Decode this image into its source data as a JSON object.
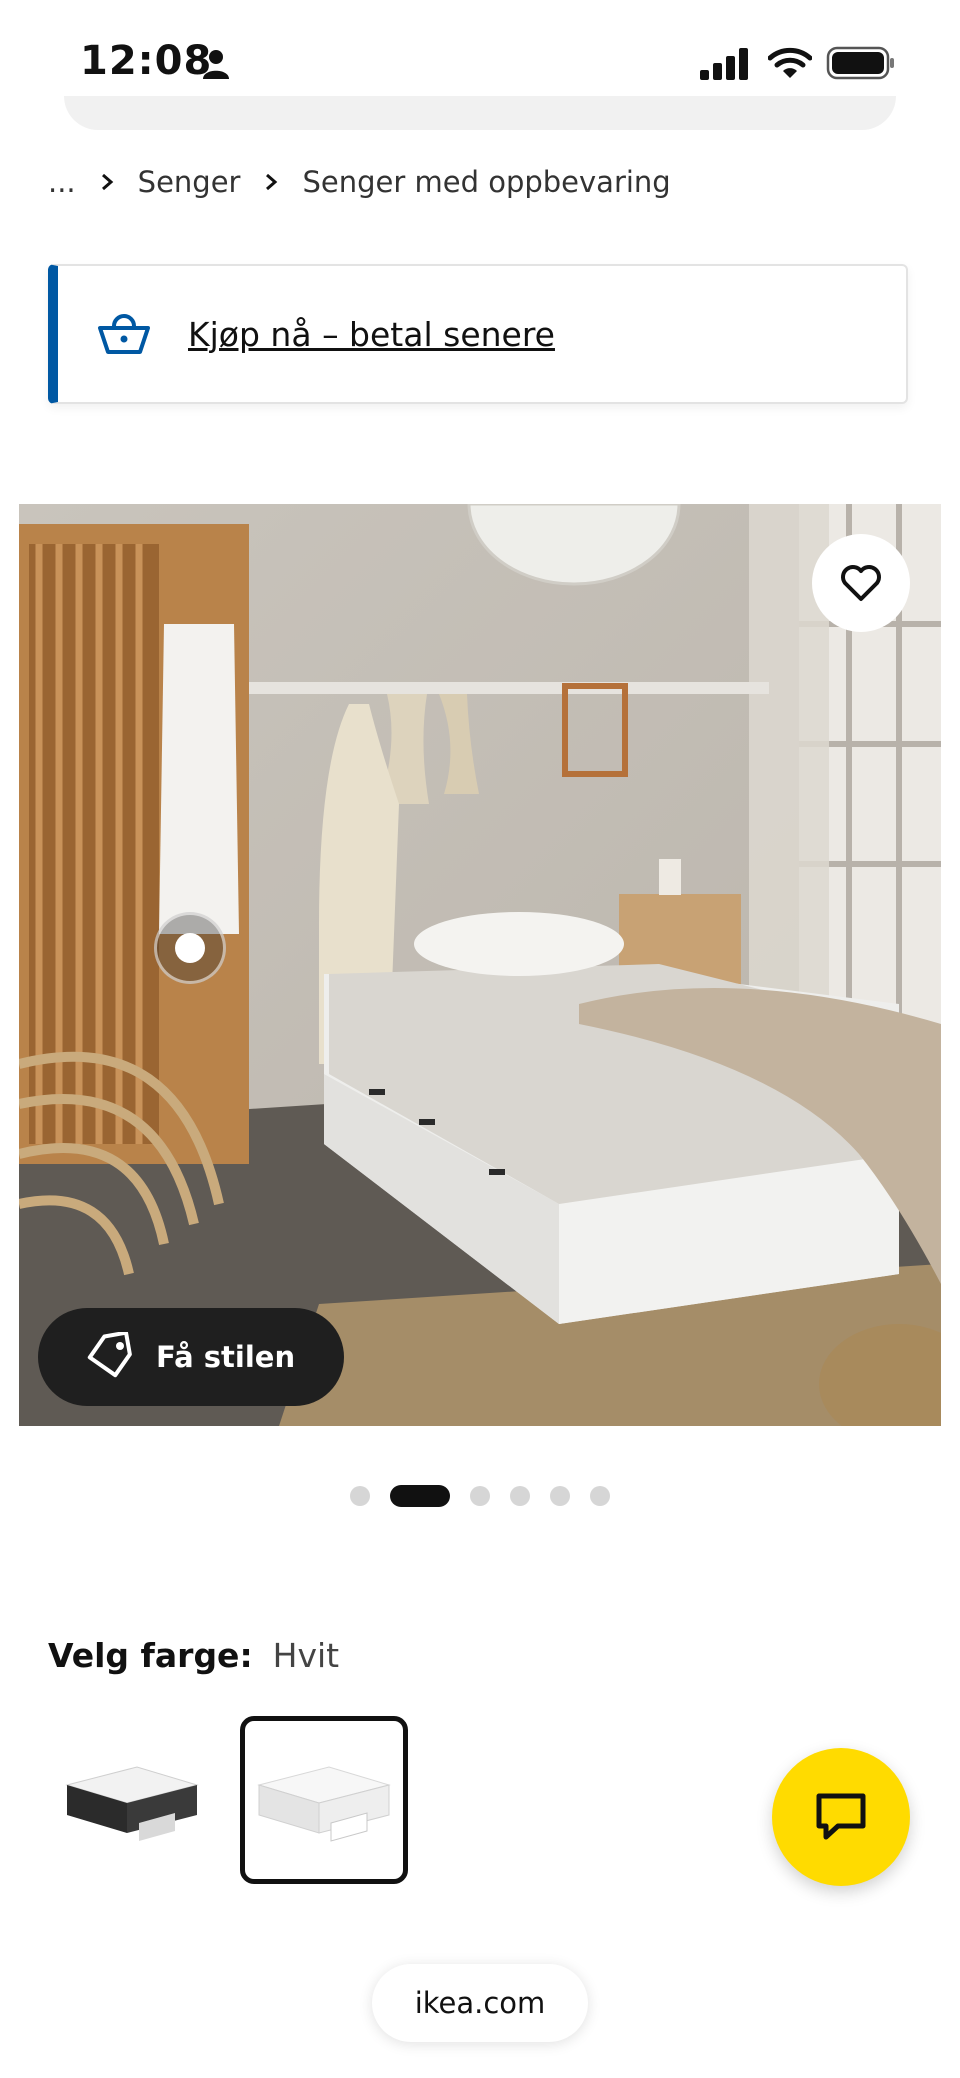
{
  "status_bar": {
    "time": "12:08"
  },
  "breadcrumb": {
    "ellipsis": "...",
    "items": [
      "Senger",
      "Senger med oppbevaring"
    ]
  },
  "banner": {
    "link_text": "Kjøp nå – betal senere",
    "accent_color": "#0058a3"
  },
  "gallery": {
    "style_button_label": "Få stilen",
    "dots_total": 6,
    "active_dot": 2
  },
  "color_selector": {
    "label": "Velg farge:",
    "selected_value": "Hvit",
    "options": [
      "black-white",
      "white"
    ]
  },
  "chat": {
    "color": "#ffdb00",
    "icon": "chat-icon"
  },
  "browser": {
    "url": "ikea.com"
  }
}
